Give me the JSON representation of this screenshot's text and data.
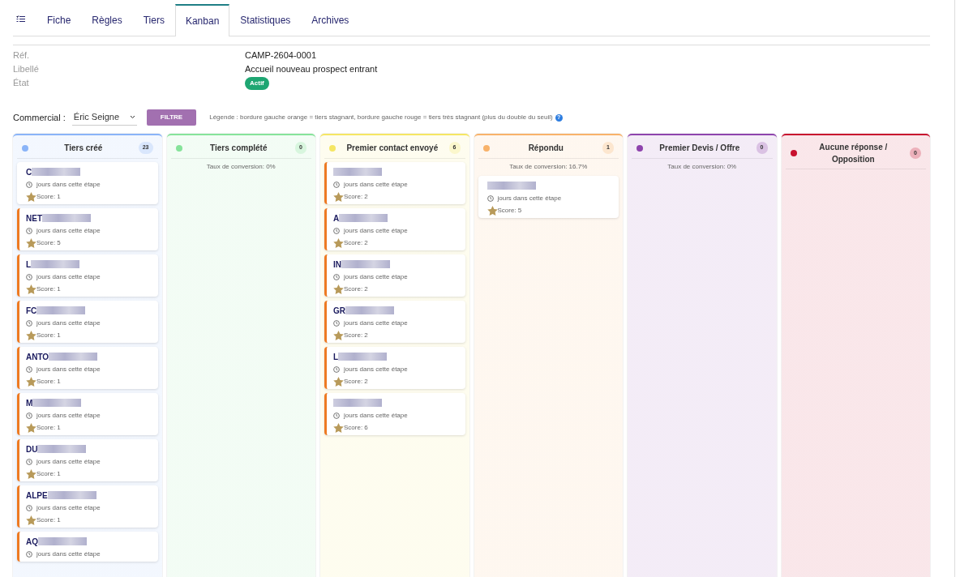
{
  "tabs": [
    {
      "label": "Fiche",
      "selected": false
    },
    {
      "label": "Règles",
      "selected": false
    },
    {
      "label": "Tiers",
      "selected": false
    },
    {
      "label": "Kanban",
      "selected": true
    },
    {
      "label": "Statistiques",
      "selected": false
    },
    {
      "label": "Archives",
      "selected": false
    }
  ],
  "fields": [
    {
      "label": "Réf.",
      "value": "CAMP-2604-0001",
      "kind": "text"
    },
    {
      "label": "Libellé",
      "value": "Accueil nouveau prospect entrant",
      "kind": "text"
    },
    {
      "label": "État",
      "value": "Actif",
      "kind": "badge"
    }
  ],
  "filter": {
    "label": "Commercial :",
    "value": "Éric Seigne",
    "button": "FILTRE",
    "legend": "Légende : bordure gauche orange = tiers stagnant, bordure gauche rouge = tiers très stagnant (plus du double du seuil)",
    "help": "?"
  },
  "columns": [
    {
      "title": "Tiers créé",
      "count": "23",
      "color": "#8ab4f8",
      "cards": [
        {
          "name": "C",
          "days": "jours dans cette étape",
          "score": "Score: 1",
          "stagnant": false
        },
        {
          "name": "NET",
          "days": "jours dans cette étape",
          "score": "Score: 5",
          "stagnant": true
        },
        {
          "name": "L",
          "days": "jours dans cette étape",
          "score": "Score: 1",
          "stagnant": true
        },
        {
          "name": "FC",
          "days": "jours dans cette étape",
          "score": "Score: 1",
          "stagnant": true
        },
        {
          "name": "ANTO",
          "days": "jours dans cette étape",
          "score": "Score: 1",
          "stagnant": true
        },
        {
          "name": "M",
          "days": "jours dans cette étape",
          "score": "Score: 1",
          "stagnant": true
        },
        {
          "name": "DU",
          "days": "jours dans cette étape",
          "score": "Score: 1",
          "stagnant": true
        },
        {
          "name": "ALPE",
          "days": "jours dans cette étape",
          "score": "Score: 1",
          "stagnant": true
        },
        {
          "name": "AQ",
          "days": "jours dans cette étape",
          "stagnant": true
        }
      ]
    },
    {
      "title": "Tiers complété",
      "count": "0",
      "color": "#86e39a",
      "conversion": "Taux de conversion: 0%"
    },
    {
      "title": "Premier contact envoyé",
      "count": "6",
      "color": "#f5e663",
      "cards": [
        {
          "days": "jours dans cette étape",
          "score": "Score: 2",
          "stagnant": true
        },
        {
          "name": "A",
          "days": "jours dans cette étape",
          "score": "Score: 2",
          "stagnant": true
        },
        {
          "name": "IN",
          "days": "jours dans cette étape",
          "score": "Score: 2",
          "stagnant": true
        },
        {
          "name": "GR",
          "days": "jours dans cette étape",
          "score": "Score: 2",
          "stagnant": true
        },
        {
          "name": "L",
          "days": "jours dans cette étape",
          "score": "Score: 2",
          "stagnant": true
        },
        {
          "days": "jours dans cette étape",
          "score": "Score: 6",
          "stagnant": true
        }
      ]
    },
    {
      "title": "Répondu",
      "count": "1",
      "color": "#f8b26a",
      "conversion": "Taux de conversion: 16.7%",
      "cards": [
        {
          "days": "jours dans cette étape",
          "score": "Score: 5",
          "stagnant": false
        }
      ]
    },
    {
      "title": "Premier Devis / Offre",
      "count": "0",
      "color": "#8e44ad",
      "conversion": "Taux de conversion: 0%"
    },
    {
      "title": "Aucune réponse / Opposition",
      "count": "0",
      "color": "#c8102e"
    }
  ]
}
